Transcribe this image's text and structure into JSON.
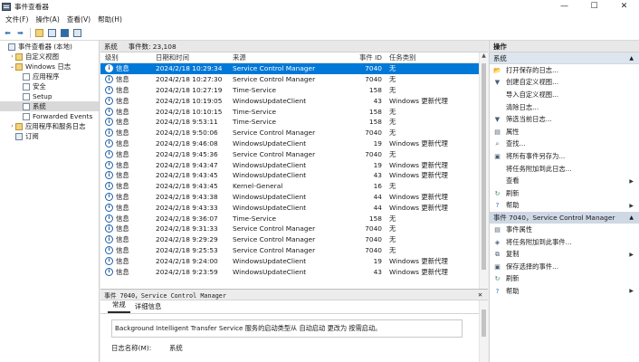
{
  "window": {
    "title": "事件查看器",
    "controls": {
      "minimize": "—",
      "maximize": "☐",
      "close": "✕"
    }
  },
  "menu": [
    "文件(F)",
    "操作(A)",
    "查看(V)",
    "帮助(H)"
  ],
  "tree": {
    "items": [
      {
        "label": "事件查看器 (本地)",
        "indent": 0,
        "twisty": "",
        "icon": "event-viewer-icon"
      },
      {
        "label": "自定义视图",
        "indent": 1,
        "twisty": "›",
        "icon": "folder-icon"
      },
      {
        "label": "Windows 日志",
        "indent": 1,
        "twisty": "⌄",
        "icon": "folder-icon"
      },
      {
        "label": "应用程序",
        "indent": 2,
        "twisty": "",
        "icon": "log-icon"
      },
      {
        "label": "安全",
        "indent": 2,
        "twisty": "",
        "icon": "log-icon"
      },
      {
        "label": "Setup",
        "indent": 2,
        "twisty": "",
        "icon": "log-icon"
      },
      {
        "label": "系统",
        "indent": 2,
        "twisty": "",
        "icon": "log-icon",
        "selected": true
      },
      {
        "label": "Forwarded Events",
        "indent": 2,
        "twisty": "",
        "icon": "log-icon"
      },
      {
        "label": "应用程序和服务日志",
        "indent": 1,
        "twisty": "›",
        "icon": "folder-icon"
      },
      {
        "label": "订阅",
        "indent": 1,
        "twisty": "",
        "icon": "subscription-icon"
      }
    ]
  },
  "log_header": {
    "name": "系统",
    "count_label": "事件数: 23,108"
  },
  "columns": {
    "level": "级别",
    "date": "日期和时间",
    "source": "来源",
    "id": "事件 ID",
    "category": "任务类别"
  },
  "events": [
    {
      "level": "信息",
      "date": "2024/2/18 10:29:34",
      "source": "Service Control Manager",
      "id": "7040",
      "category": "无",
      "selected": true
    },
    {
      "level": "信息",
      "date": "2024/2/18 10:27:30",
      "source": "Service Control Manager",
      "id": "7040",
      "category": "无"
    },
    {
      "level": "信息",
      "date": "2024/2/18 10:27:19",
      "source": "Time-Service",
      "id": "158",
      "category": "无"
    },
    {
      "level": "信息",
      "date": "2024/2/18 10:19:05",
      "source": "WindowsUpdateClient",
      "id": "43",
      "category": "Windows 更新代理"
    },
    {
      "level": "信息",
      "date": "2024/2/18 10:10:15",
      "source": "Time-Service",
      "id": "158",
      "category": "无"
    },
    {
      "level": "信息",
      "date": "2024/2/18 9:53:11",
      "source": "Time-Service",
      "id": "158",
      "category": "无"
    },
    {
      "level": "信息",
      "date": "2024/2/18 9:50:06",
      "source": "Service Control Manager",
      "id": "7040",
      "category": "无"
    },
    {
      "level": "信息",
      "date": "2024/2/18 9:46:08",
      "source": "WindowsUpdateClient",
      "id": "19",
      "category": "Windows 更新代理"
    },
    {
      "level": "信息",
      "date": "2024/2/18 9:45:36",
      "source": "Service Control Manager",
      "id": "7040",
      "category": "无"
    },
    {
      "level": "信息",
      "date": "2024/2/18 9:43:47",
      "source": "WindowsUpdateClient",
      "id": "19",
      "category": "Windows 更新代理"
    },
    {
      "level": "信息",
      "date": "2024/2/18 9:43:45",
      "source": "WindowsUpdateClient",
      "id": "43",
      "category": "Windows 更新代理"
    },
    {
      "level": "信息",
      "date": "2024/2/18 9:43:45",
      "source": "Kernel-General",
      "id": "16",
      "category": "无"
    },
    {
      "level": "信息",
      "date": "2024/2/18 9:43:38",
      "source": "WindowsUpdateClient",
      "id": "44",
      "category": "Windows 更新代理"
    },
    {
      "level": "信息",
      "date": "2024/2/18 9:43:33",
      "source": "WindowsUpdateClient",
      "id": "44",
      "category": "Windows 更新代理"
    },
    {
      "level": "信息",
      "date": "2024/2/18 9:36:07",
      "source": "Time-Service",
      "id": "158",
      "category": "无"
    },
    {
      "level": "信息",
      "date": "2024/2/18 9:31:33",
      "source": "Service Control Manager",
      "id": "7040",
      "category": "无"
    },
    {
      "level": "信息",
      "date": "2024/2/18 9:29:29",
      "source": "Service Control Manager",
      "id": "7040",
      "category": "无"
    },
    {
      "level": "信息",
      "date": "2024/2/18 9:25:53",
      "source": "Service Control Manager",
      "id": "7040",
      "category": "无"
    },
    {
      "level": "信息",
      "date": "2024/2/18 9:24:00",
      "source": "WindowsUpdateClient",
      "id": "19",
      "category": "Windows 更新代理"
    },
    {
      "level": "信息",
      "date": "2024/2/18 9:23:59",
      "source": "WindowsUpdateClient",
      "id": "43",
      "category": "Windows 更新代理"
    }
  ],
  "detail": {
    "title": "事件 7040，Service Control Manager",
    "close": "✕",
    "tabs": [
      "常规",
      "详细信息"
    ],
    "description": "Background Intelligent Transfer Service 服务的启动类型从 自动启动 更改为 按需启动。",
    "log_name_label": "日志名称(M):",
    "log_name_value": "系统"
  },
  "actions": {
    "title": "操作",
    "section1": "系统",
    "section1_items": [
      {
        "label": "打开保存的日志...",
        "icon": "open-log-icon",
        "glyph": "📂"
      },
      {
        "label": "创建自定义视图...",
        "icon": "filter-icon",
        "glyph": "▼"
      },
      {
        "label": "导入自定义视图...",
        "icon": "import-icon",
        "glyph": ""
      },
      {
        "label": "清除日志...",
        "icon": "clear-log-icon",
        "glyph": ""
      },
      {
        "label": "筛选当前日志...",
        "icon": "filter-icon",
        "glyph": "▼"
      },
      {
        "label": "属性",
        "icon": "properties-icon",
        "glyph": "▤"
      },
      {
        "label": "查找...",
        "icon": "find-icon",
        "glyph": "⌕"
      },
      {
        "label": "将所有事件另存为...",
        "icon": "save-icon",
        "glyph": "▣"
      },
      {
        "label": "将任务附加到此日志...",
        "icon": "attach-task-icon",
        "glyph": ""
      },
      {
        "label": "查看",
        "icon": "view-icon",
        "glyph": "",
        "submenu": true
      },
      {
        "label": "刷新",
        "icon": "refresh-icon",
        "glyph": "↻"
      },
      {
        "label": "帮助",
        "icon": "help-icon",
        "glyph": "?",
        "submenu": true
      }
    ],
    "section2": "事件 7040，Service Control Manager",
    "section2_items": [
      {
        "label": "事件属性",
        "icon": "event-properties-icon",
        "glyph": "▤"
      },
      {
        "label": "将任务附加到此事件...",
        "icon": "attach-task-icon",
        "glyph": "◈"
      },
      {
        "label": "复制",
        "icon": "copy-icon",
        "glyph": "⧉",
        "submenu": true
      },
      {
        "label": "保存选择的事件...",
        "icon": "save-icon",
        "glyph": "▣"
      },
      {
        "label": "刷新",
        "icon": "refresh-icon",
        "glyph": "↻"
      },
      {
        "label": "帮助",
        "icon": "help-icon",
        "glyph": "?",
        "submenu": true
      }
    ]
  },
  "colors": {
    "selection": "#0078d7",
    "info_icon": "#1f5fa6",
    "folder": "#f2d27a"
  }
}
